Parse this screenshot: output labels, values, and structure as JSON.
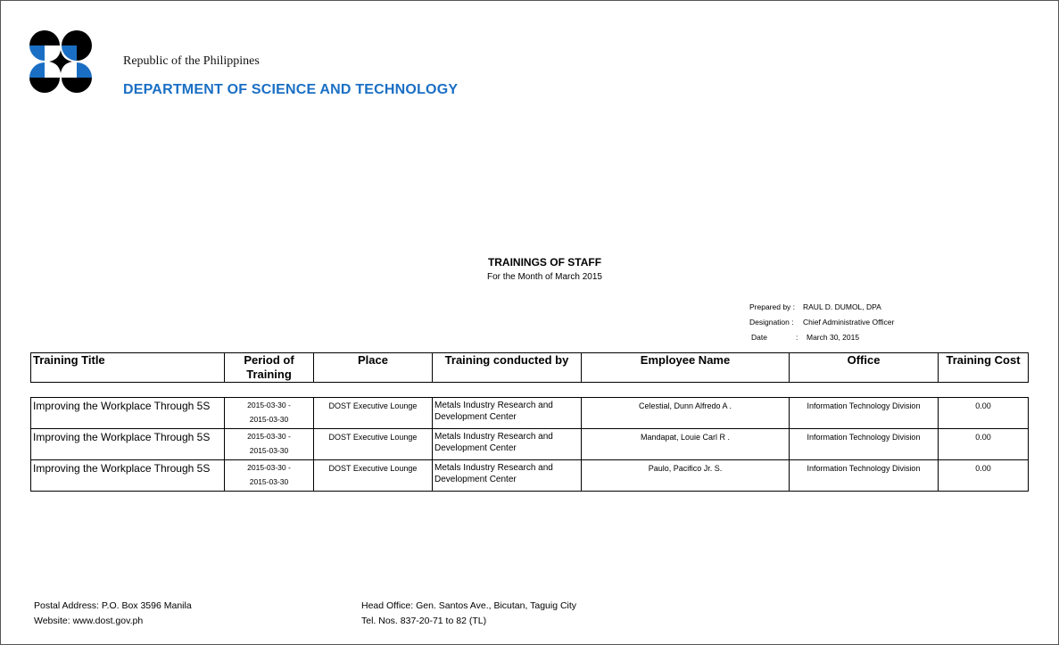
{
  "header": {
    "republic": "Republic of the Philippines",
    "department": "DEPARTMENT OF SCIENCE AND TECHNOLOGY",
    "logo_colors": [
      "#000000",
      "#1a6fc4"
    ]
  },
  "report": {
    "title": "TRAININGS OF STAFF",
    "subtitle": "For the Month of March 2015"
  },
  "meta": {
    "prepared_by_label": "Prepared by :",
    "prepared_by_value": "RAUL D. DUMOL, DPA",
    "designation_label": "Designation :",
    "designation_value": "Chief Administrative Officer",
    "date_label": "Date",
    "date_sep": ":",
    "date_value": "March 30,  2015"
  },
  "table": {
    "columns": [
      "Training Title",
      "Period of Training",
      "Place",
      "Training conducted by",
      "Employee Name",
      "Office",
      "Training Cost"
    ],
    "rows": [
      {
        "title": "Improving the Workplace Through 5S",
        "period_start": "2015-03-30 -",
        "period_end": "2015-03-30",
        "place": "DOST Executive Lounge",
        "conducted_by_1": "Metals Industry Research and",
        "conducted_by_2": "Development Center",
        "employee": "Celestial, Dunn Alfredo  A .",
        "office": "Information Technology Division",
        "cost": "0.00"
      },
      {
        "title": "Improving the Workplace Through 5S",
        "period_start": "2015-03-30 -",
        "period_end": "2015-03-30",
        "place": "DOST Executive Lounge",
        "conducted_by_1": "Metals Industry Research and",
        "conducted_by_2": "Development Center",
        "employee": "Mandapat, Louie Carl  R .",
        "office": "Information Technology Division",
        "cost": "0.00"
      },
      {
        "title": "Improving the Workplace Through 5S",
        "period_start": "2015-03-30 -",
        "period_end": "2015-03-30",
        "place": "DOST Executive Lounge",
        "conducted_by_1": "Metals Industry Research and",
        "conducted_by_2": "Development Center",
        "employee": "Paulo, Pacifico Jr. S.",
        "office": "Information Technology Division",
        "cost": "0.00"
      }
    ]
  },
  "footer": {
    "postal": "Postal Address: P.O. Box 3596 Manila",
    "website": "Website: www.dost.gov.ph",
    "head_office": "Head Office: Gen. Santos Ave., Bicutan, Taguig City",
    "tel": "Tel. Nos. 837-20-71 to 82 (TL)"
  }
}
